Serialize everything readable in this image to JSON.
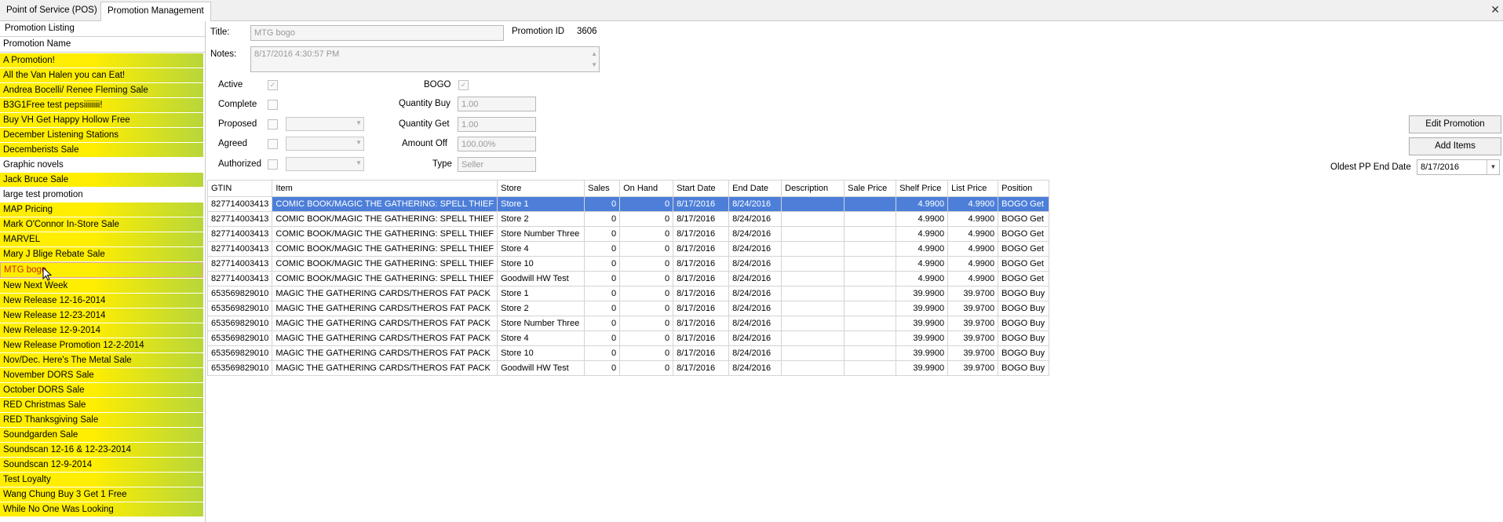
{
  "tabs": [
    {
      "label": "Point of Service (POS)"
    },
    {
      "label": "Promotion Management"
    }
  ],
  "close_glyph": "✕",
  "left_panel": {
    "title": "Promotion Listing",
    "column_header": "Promotion Name",
    "items": [
      "A Promotion!",
      "All the Van Halen you can Eat!",
      "Andrea Bocelli/ Renee Fleming Sale",
      "B3G1Free test pepsiiiiiiii!",
      "Buy VH Get Happy Hollow Free",
      "December Listening Stations",
      "Decemberists Sale",
      "Graphic novels",
      "Jack Bruce Sale",
      "large test promotion",
      "MAP Pricing",
      "Mark O'Connor In-Store Sale",
      "MARVEL",
      "Mary J Blige Rebate Sale",
      "MTG bogo",
      "New Next Week",
      "New Release 12-16-2014",
      "New Release 12-23-2014",
      "New Release 12-9-2014",
      "New Release Promotion 12-2-2014",
      "Nov/Dec. Here's The Metal Sale",
      "November DORS Sale",
      "October DORS Sale",
      "RED Christmas Sale",
      "RED Thanksgiving Sale",
      "Soundgarden Sale",
      "Soundscan 12-16 & 12-23-2014",
      "Soundscan 12-9-2014",
      "Test Loyalty",
      "Wang Chung Buy 3 Get 1 Free",
      "While No One Was Looking"
    ],
    "plain_items": [
      "Graphic novels",
      "large test promotion"
    ],
    "selected_item": "MTG bogo"
  },
  "form": {
    "title_label": "Title:",
    "title_value": "MTG bogo",
    "promo_id_label": "Promotion ID",
    "promo_id_value": "3606",
    "notes_label": "Notes:",
    "notes_value": "8/17/2016 4:30:57 PM",
    "active_label": "Active",
    "complete_label": "Complete",
    "proposed_label": "Proposed",
    "agreed_label": "Agreed",
    "authorized_label": "Authorized",
    "bogo_label": "BOGO",
    "qty_buy_label": "Quantity Buy",
    "qty_buy_value": "1.00",
    "qty_get_label": "Quantity Get",
    "qty_get_value": "1.00",
    "amount_off_label": "Amount Off",
    "amount_off_value": "100.00%",
    "type_label": "Type",
    "type_value": "Seller",
    "edit_button": "Edit Promotion",
    "add_items_button": "Add Items",
    "oldest_label": "Oldest PP End Date",
    "oldest_value": "8/17/2016"
  },
  "grid": {
    "columns": [
      "GTIN",
      "Item",
      "Store",
      "Sales",
      "On Hand",
      "Start Date",
      "End Date",
      "Description",
      "Sale Price",
      "Shelf Price",
      "List Price",
      "Position"
    ],
    "rows": [
      [
        "827714003413",
        "COMIC BOOK/MAGIC THE GATHERING: SPELL THIEF",
        "Store 1",
        "0",
        "0",
        "8/17/2016",
        "8/24/2016",
        "",
        "",
        "4.9900",
        "4.9900",
        "BOGO Get"
      ],
      [
        "827714003413",
        "COMIC BOOK/MAGIC THE GATHERING: SPELL THIEF",
        "Store 2",
        "0",
        "0",
        "8/17/2016",
        "8/24/2016",
        "",
        "",
        "4.9900",
        "4.9900",
        "BOGO Get"
      ],
      [
        "827714003413",
        "COMIC BOOK/MAGIC THE GATHERING: SPELL THIEF",
        "Store Number Three",
        "0",
        "0",
        "8/17/2016",
        "8/24/2016",
        "",
        "",
        "4.9900",
        "4.9900",
        "BOGO Get"
      ],
      [
        "827714003413",
        "COMIC BOOK/MAGIC THE GATHERING: SPELL THIEF",
        "Store 4",
        "0",
        "0",
        "8/17/2016",
        "8/24/2016",
        "",
        "",
        "4.9900",
        "4.9900",
        "BOGO Get"
      ],
      [
        "827714003413",
        "COMIC BOOK/MAGIC THE GATHERING: SPELL THIEF",
        "Store 10",
        "0",
        "0",
        "8/17/2016",
        "8/24/2016",
        "",
        "",
        "4.9900",
        "4.9900",
        "BOGO Get"
      ],
      [
        "827714003413",
        "COMIC BOOK/MAGIC THE GATHERING: SPELL THIEF",
        "Goodwill HW Test",
        "0",
        "0",
        "8/17/2016",
        "8/24/2016",
        "",
        "",
        "4.9900",
        "4.9900",
        "BOGO Get"
      ],
      [
        "653569829010",
        "MAGIC THE GATHERING CARDS/THEROS FAT PACK",
        "Store 1",
        "0",
        "0",
        "8/17/2016",
        "8/24/2016",
        "",
        "",
        "39.9900",
        "39.9700",
        "BOGO Buy"
      ],
      [
        "653569829010",
        "MAGIC THE GATHERING CARDS/THEROS FAT PACK",
        "Store 2",
        "0",
        "0",
        "8/17/2016",
        "8/24/2016",
        "",
        "",
        "39.9900",
        "39.9700",
        "BOGO Buy"
      ],
      [
        "653569829010",
        "MAGIC THE GATHERING CARDS/THEROS FAT PACK",
        "Store Number Three",
        "0",
        "0",
        "8/17/2016",
        "8/24/2016",
        "",
        "",
        "39.9900",
        "39.9700",
        "BOGO Buy"
      ],
      [
        "653569829010",
        "MAGIC THE GATHERING CARDS/THEROS FAT PACK",
        "Store 4",
        "0",
        "0",
        "8/17/2016",
        "8/24/2016",
        "",
        "",
        "39.9900",
        "39.9700",
        "BOGO Buy"
      ],
      [
        "653569829010",
        "MAGIC THE GATHERING CARDS/THEROS FAT PACK",
        "Store 10",
        "0",
        "0",
        "8/17/2016",
        "8/24/2016",
        "",
        "",
        "39.9900",
        "39.9700",
        "BOGO Buy"
      ],
      [
        "653569829010",
        "MAGIC THE GATHERING CARDS/THEROS FAT PACK",
        "Goodwill HW Test",
        "0",
        "0",
        "8/17/2016",
        "8/24/2016",
        "",
        "",
        "39.9900",
        "39.9700",
        "BOGO Buy"
      ]
    ],
    "selected_row": 0
  },
  "colors": {
    "promo_yellow": "#ffee00",
    "promo_green": "#b8d63a",
    "selection_blue": "#4d7fd9",
    "selected_text": "#cc2200"
  }
}
